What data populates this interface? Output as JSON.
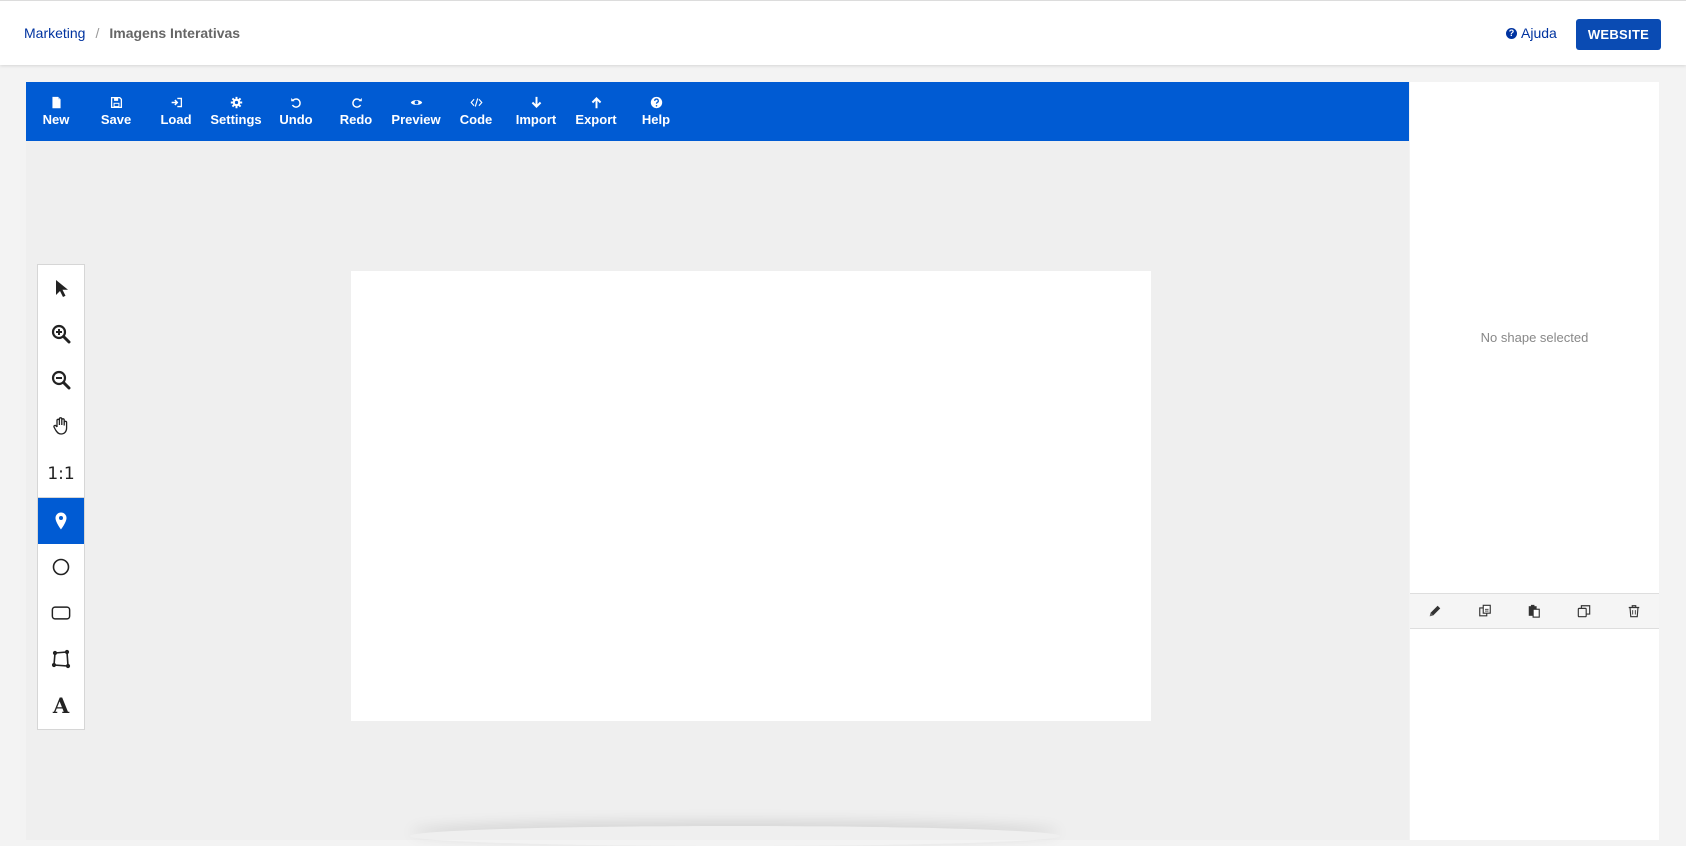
{
  "breadcrumb": {
    "parent": "Marketing",
    "separator": "/",
    "current": "Imagens Interativas"
  },
  "header": {
    "help_label": "Ajuda",
    "website_label": "WEBSITE"
  },
  "toolbar": {
    "items": [
      {
        "label": "New",
        "icon": "file-icon"
      },
      {
        "label": "Save",
        "icon": "floppy-icon"
      },
      {
        "label": "Load",
        "icon": "sign-in-icon"
      },
      {
        "label": "Settings",
        "icon": "gear-icon"
      },
      {
        "label": "Undo",
        "icon": "undo-icon"
      },
      {
        "label": "Redo",
        "icon": "redo-icon"
      },
      {
        "label": "Preview",
        "icon": "eye-icon"
      },
      {
        "label": "Code",
        "icon": "code-icon"
      },
      {
        "label": "Import",
        "icon": "arrow-down-icon"
      },
      {
        "label": "Export",
        "icon": "arrow-up-icon"
      },
      {
        "label": "Help",
        "icon": "question-icon"
      }
    ]
  },
  "tools": {
    "zoom_reset_label": "1:1",
    "text_tool_label": "A",
    "active_tool": "spot-tool"
  },
  "sidebar": {
    "empty_message": "No shape selected"
  },
  "colors": {
    "brand_blue": "#005bd3",
    "button_blue": "#0a4bb3",
    "link_blue": "#0033a0"
  }
}
